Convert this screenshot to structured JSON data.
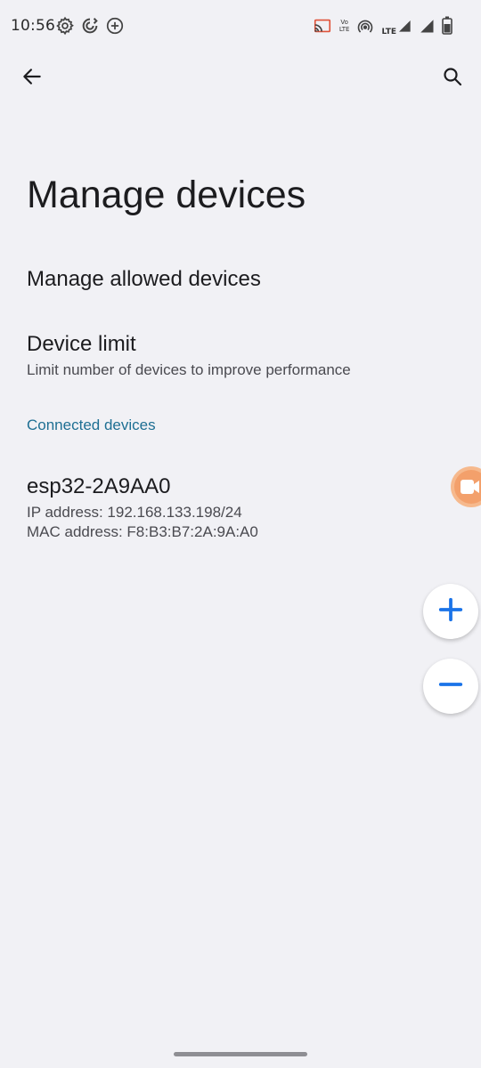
{
  "status_bar": {
    "time": "10:56",
    "volte_label_top": "Vo",
    "volte_label_bottom": "LTE",
    "lte_label": "LTE",
    "icons": [
      "settings-gear-icon",
      "sync-icon",
      "add-circle-icon",
      "cast-icon",
      "volte-icon",
      "hotspot-icon",
      "signal-icon",
      "battery-icon"
    ]
  },
  "app_bar": {
    "back_icon": "arrow-back-icon",
    "search_icon": "search-icon"
  },
  "page": {
    "title": "Manage devices"
  },
  "preferences": {
    "manage_allowed": {
      "title": "Manage allowed devices"
    },
    "device_limit": {
      "title": "Device limit",
      "summary": "Limit number of devices to improve performance"
    }
  },
  "connected_devices": {
    "header": "Connected devices",
    "devices": [
      {
        "name": "esp32-2A9AA0",
        "ip": "IP address: 192.168.133.198/24",
        "mac": "MAC address: F8:B3:B7:2A:9A:A0"
      }
    ]
  },
  "floating": {
    "zoom_in_icon": "plus-icon",
    "zoom_out_icon": "minus-icon",
    "record_icon": "video-camera-icon"
  },
  "colors": {
    "background": "#f1f1f5",
    "accent": "#1e6f93",
    "fab_icon": "#1a73e8",
    "record_bubble": "#f3a06b"
  }
}
